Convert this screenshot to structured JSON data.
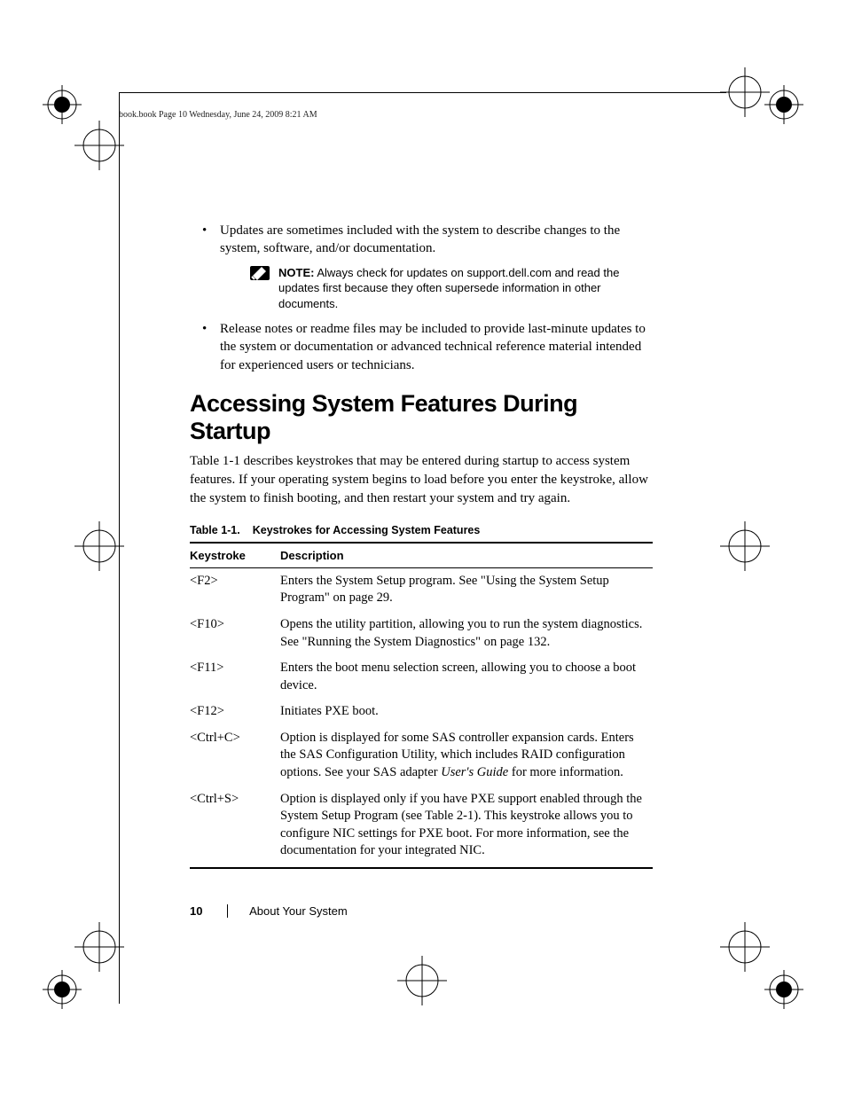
{
  "header": {
    "running": "book.book  Page 10  Wednesday, June 24, 2009  8:21 AM"
  },
  "bullets": {
    "b1": "Updates are sometimes included with the system to describe changes to the system, software, and/or documentation.",
    "note_label": "NOTE:",
    "note_text_pre": " Always check for updates on ",
    "note_bold": "support.dell.com",
    "note_text_post": " and read the updates first because they often supersede information in other documents.",
    "b2": "Release notes or readme files may be included to provide last-minute updates to the system or documentation or advanced technical reference material intended for experienced users or technicians."
  },
  "section": {
    "title": "Accessing System Features During Startup",
    "intro": "Table 1-1 describes keystrokes that may be entered during startup to access system features. If your operating system begins to load before you enter the keystroke, allow the system to finish booting, and then restart your system and try again."
  },
  "table": {
    "caption_num": "Table 1-1.",
    "caption_title": "Keystrokes for Accessing System Features",
    "head_key": "Keystroke",
    "head_desc": "Description",
    "rows": [
      {
        "k": "<F2>",
        "d": "Enters the System Setup program. See \"Using the System Setup Program\" on page 29."
      },
      {
        "k": "<F10>",
        "d": "Opens the utility partition, allowing you to run the system diagnostics. See \"Running the System Diagnostics\" on page 132."
      },
      {
        "k": "<F11>",
        "d": "Enters the boot menu selection screen, allowing you to choose a boot device."
      },
      {
        "k": "<F12>",
        "d": "Initiates PXE boot."
      },
      {
        "k": "<Ctrl+C>",
        "d_pre": "Option is displayed for some SAS controller expansion cards. Enters the SAS Configuration Utility, which includes RAID configuration options. See your SAS adapter ",
        "d_italic": "User's Guide",
        "d_post": " for more information."
      },
      {
        "k": "<Ctrl+S>",
        "d": "Option is displayed only if you have PXE support enabled through the System Setup Program (see Table 2-1). This keystroke allows you to configure NIC settings for PXE boot. For more information, see the documentation for your integrated NIC."
      }
    ]
  },
  "footer": {
    "page_number": "10",
    "section_name": "About Your System"
  }
}
